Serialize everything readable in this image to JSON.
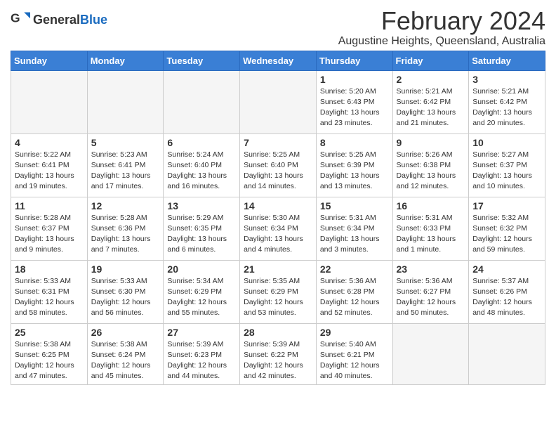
{
  "app": {
    "logo_general": "General",
    "logo_blue": "Blue"
  },
  "header": {
    "title": "February 2024",
    "location": "Augustine Heights, Queensland, Australia"
  },
  "weekdays": [
    "Sunday",
    "Monday",
    "Tuesday",
    "Wednesday",
    "Thursday",
    "Friday",
    "Saturday"
  ],
  "weeks": [
    [
      {
        "day": "",
        "info": ""
      },
      {
        "day": "",
        "info": ""
      },
      {
        "day": "",
        "info": ""
      },
      {
        "day": "",
        "info": ""
      },
      {
        "day": "1",
        "info": "Sunrise: 5:20 AM\nSunset: 6:43 PM\nDaylight: 13 hours\nand 23 minutes."
      },
      {
        "day": "2",
        "info": "Sunrise: 5:21 AM\nSunset: 6:42 PM\nDaylight: 13 hours\nand 21 minutes."
      },
      {
        "day": "3",
        "info": "Sunrise: 5:21 AM\nSunset: 6:42 PM\nDaylight: 13 hours\nand 20 minutes."
      }
    ],
    [
      {
        "day": "4",
        "info": "Sunrise: 5:22 AM\nSunset: 6:41 PM\nDaylight: 13 hours\nand 19 minutes."
      },
      {
        "day": "5",
        "info": "Sunrise: 5:23 AM\nSunset: 6:41 PM\nDaylight: 13 hours\nand 17 minutes."
      },
      {
        "day": "6",
        "info": "Sunrise: 5:24 AM\nSunset: 6:40 PM\nDaylight: 13 hours\nand 16 minutes."
      },
      {
        "day": "7",
        "info": "Sunrise: 5:25 AM\nSunset: 6:40 PM\nDaylight: 13 hours\nand 14 minutes."
      },
      {
        "day": "8",
        "info": "Sunrise: 5:25 AM\nSunset: 6:39 PM\nDaylight: 13 hours\nand 13 minutes."
      },
      {
        "day": "9",
        "info": "Sunrise: 5:26 AM\nSunset: 6:38 PM\nDaylight: 13 hours\nand 12 minutes."
      },
      {
        "day": "10",
        "info": "Sunrise: 5:27 AM\nSunset: 6:37 PM\nDaylight: 13 hours\nand 10 minutes."
      }
    ],
    [
      {
        "day": "11",
        "info": "Sunrise: 5:28 AM\nSunset: 6:37 PM\nDaylight: 13 hours\nand 9 minutes."
      },
      {
        "day": "12",
        "info": "Sunrise: 5:28 AM\nSunset: 6:36 PM\nDaylight: 13 hours\nand 7 minutes."
      },
      {
        "day": "13",
        "info": "Sunrise: 5:29 AM\nSunset: 6:35 PM\nDaylight: 13 hours\nand 6 minutes."
      },
      {
        "day": "14",
        "info": "Sunrise: 5:30 AM\nSunset: 6:34 PM\nDaylight: 13 hours\nand 4 minutes."
      },
      {
        "day": "15",
        "info": "Sunrise: 5:31 AM\nSunset: 6:34 PM\nDaylight: 13 hours\nand 3 minutes."
      },
      {
        "day": "16",
        "info": "Sunrise: 5:31 AM\nSunset: 6:33 PM\nDaylight: 13 hours\nand 1 minute."
      },
      {
        "day": "17",
        "info": "Sunrise: 5:32 AM\nSunset: 6:32 PM\nDaylight: 12 hours\nand 59 minutes."
      }
    ],
    [
      {
        "day": "18",
        "info": "Sunrise: 5:33 AM\nSunset: 6:31 PM\nDaylight: 12 hours\nand 58 minutes."
      },
      {
        "day": "19",
        "info": "Sunrise: 5:33 AM\nSunset: 6:30 PM\nDaylight: 12 hours\nand 56 minutes."
      },
      {
        "day": "20",
        "info": "Sunrise: 5:34 AM\nSunset: 6:29 PM\nDaylight: 12 hours\nand 55 minutes."
      },
      {
        "day": "21",
        "info": "Sunrise: 5:35 AM\nSunset: 6:29 PM\nDaylight: 12 hours\nand 53 minutes."
      },
      {
        "day": "22",
        "info": "Sunrise: 5:36 AM\nSunset: 6:28 PM\nDaylight: 12 hours\nand 52 minutes."
      },
      {
        "day": "23",
        "info": "Sunrise: 5:36 AM\nSunset: 6:27 PM\nDaylight: 12 hours\nand 50 minutes."
      },
      {
        "day": "24",
        "info": "Sunrise: 5:37 AM\nSunset: 6:26 PM\nDaylight: 12 hours\nand 48 minutes."
      }
    ],
    [
      {
        "day": "25",
        "info": "Sunrise: 5:38 AM\nSunset: 6:25 PM\nDaylight: 12 hours\nand 47 minutes."
      },
      {
        "day": "26",
        "info": "Sunrise: 5:38 AM\nSunset: 6:24 PM\nDaylight: 12 hours\nand 45 minutes."
      },
      {
        "day": "27",
        "info": "Sunrise: 5:39 AM\nSunset: 6:23 PM\nDaylight: 12 hours\nand 44 minutes."
      },
      {
        "day": "28",
        "info": "Sunrise: 5:39 AM\nSunset: 6:22 PM\nDaylight: 12 hours\nand 42 minutes."
      },
      {
        "day": "29",
        "info": "Sunrise: 5:40 AM\nSunset: 6:21 PM\nDaylight: 12 hours\nand 40 minutes."
      },
      {
        "day": "",
        "info": ""
      },
      {
        "day": "",
        "info": ""
      }
    ]
  ]
}
